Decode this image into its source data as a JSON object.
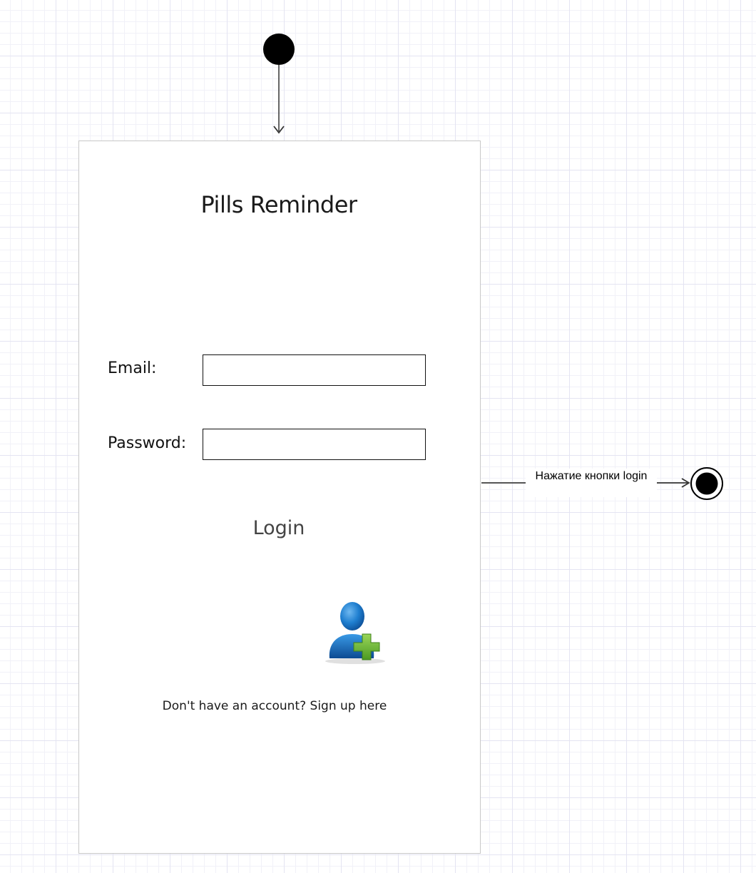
{
  "app": {
    "title": "Pills Reminder"
  },
  "form": {
    "email_label": "Email:",
    "email_value": "",
    "password_label": "Password:",
    "password_value": "",
    "login_label": "Login"
  },
  "signup": {
    "icon": "add-user-icon",
    "text": "Don't have an account? Sign up here"
  },
  "transition": {
    "label": "Нажатие кнопки login"
  },
  "colors": {
    "grid_line": "#e4e4f2",
    "phone_border": "#c8c8c8",
    "user_icon_blue": "#1e78c8",
    "plus_icon_green": "#6fbf3a"
  }
}
